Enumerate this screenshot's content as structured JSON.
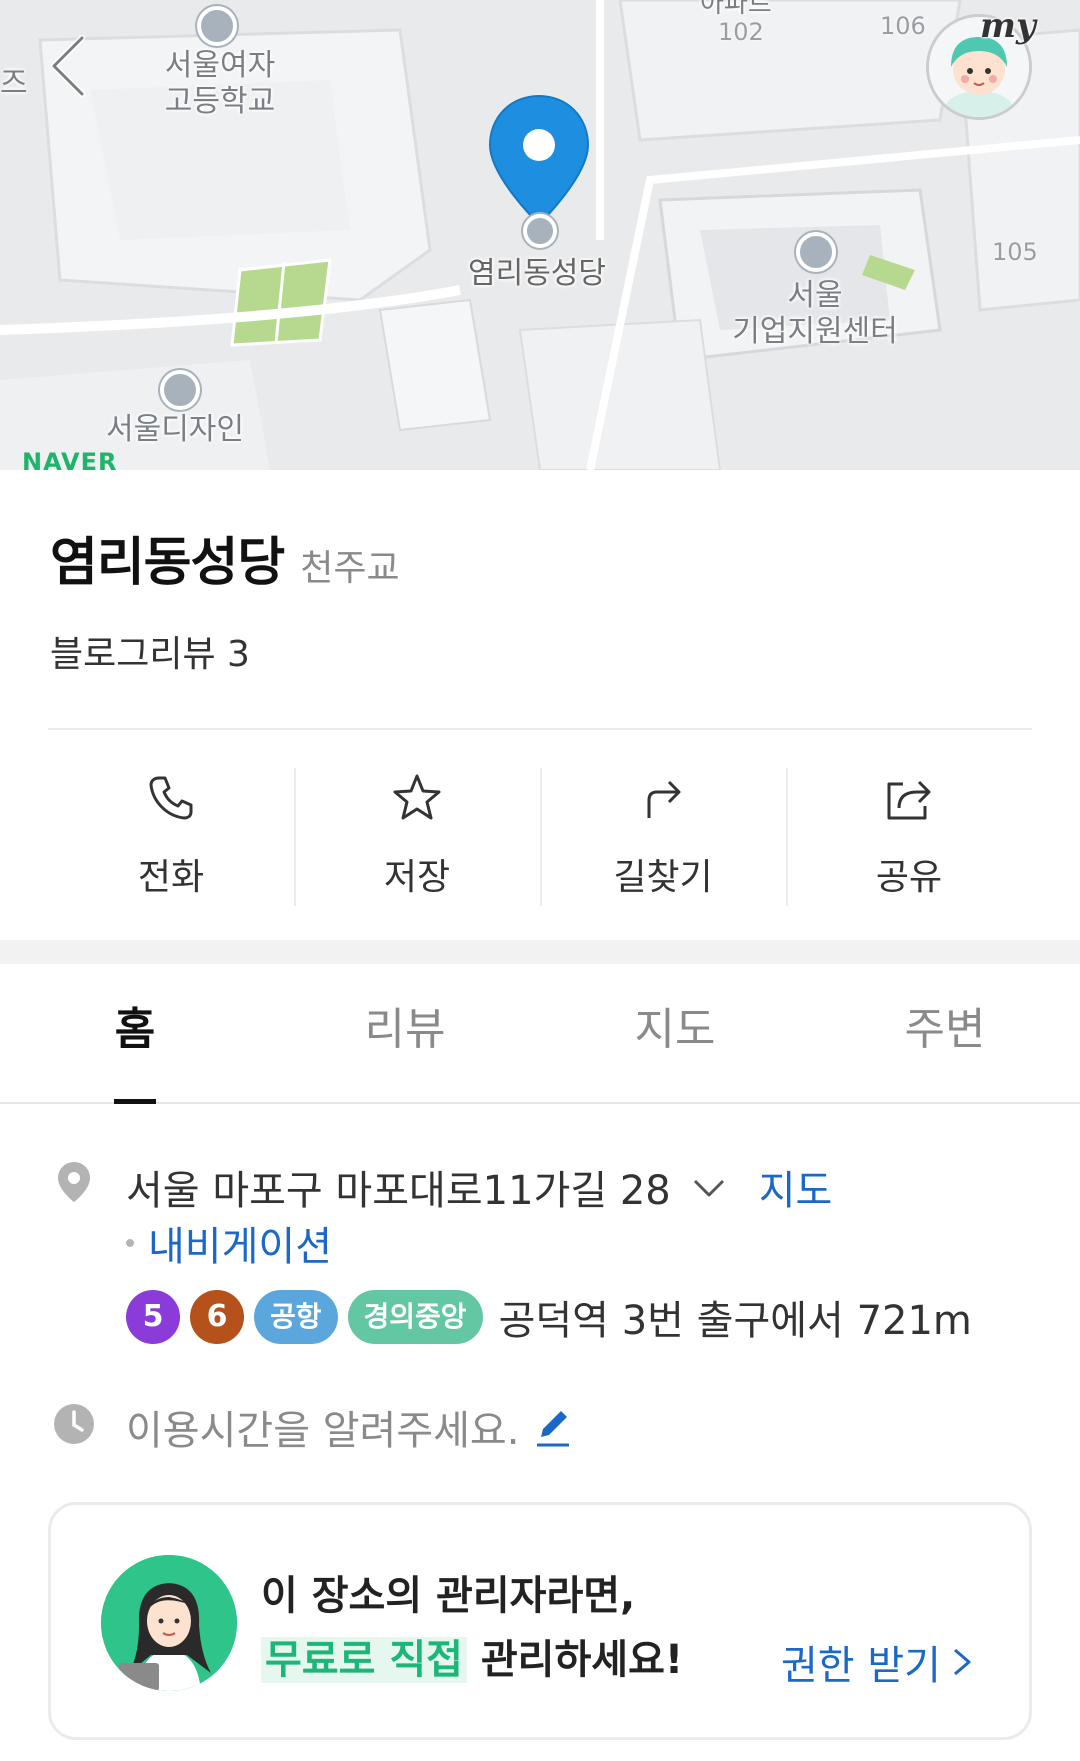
{
  "map": {
    "labels": {
      "girls_high": "서울여자\n고등학교",
      "place_pin": "염리동성당",
      "enterprise_center": "서울\n기업지원센터",
      "design_high": "서울디자인",
      "partial_left": "즈",
      "apartment": "아파트",
      "num_102": "102",
      "num_106": "106",
      "num_105": "105"
    },
    "pin_color": "#1e8fe0",
    "naver_logo": "NAVER",
    "my_badge": "my"
  },
  "place": {
    "name": "염리동성당",
    "category": "천주교",
    "blog_review": "블로그리뷰 3"
  },
  "actions": [
    {
      "label": "전화",
      "icon": "phone-icon"
    },
    {
      "label": "저장",
      "icon": "star-icon"
    },
    {
      "label": "길찾기",
      "icon": "directions-icon"
    },
    {
      "label": "공유",
      "icon": "share-icon"
    }
  ],
  "tabs": [
    {
      "label": "홈",
      "active": true
    },
    {
      "label": "리뷰",
      "active": false
    },
    {
      "label": "지도",
      "active": false
    },
    {
      "label": "주변",
      "active": false
    }
  ],
  "info": {
    "address": "서울 마포구 마포대로11가길 28",
    "map_link": "지도",
    "navigation_link": "내비게이션",
    "subway": {
      "badges": [
        {
          "text": "5",
          "color": "#8b3bd9",
          "shape": "circle"
        },
        {
          "text": "6",
          "color": "#b5521b",
          "shape": "circle"
        },
        {
          "text": "공항",
          "color": "#5aa6dd",
          "shape": "pill"
        },
        {
          "text": "경의중앙",
          "color": "#64c7a3",
          "shape": "pill"
        }
      ],
      "text": "공덕역 3번 출구에서 721m"
    },
    "hours_prompt": "이용시간을 알려주세요."
  },
  "owner_card": {
    "line1": "이 장소의 관리자라면,",
    "line2_highlight": "무료로 직접",
    "line2_rest": " 관리하세요!",
    "cta": "권한 받기"
  },
  "colors": {
    "link": "#1c68c7",
    "highlight_green": "#1cb778"
  }
}
